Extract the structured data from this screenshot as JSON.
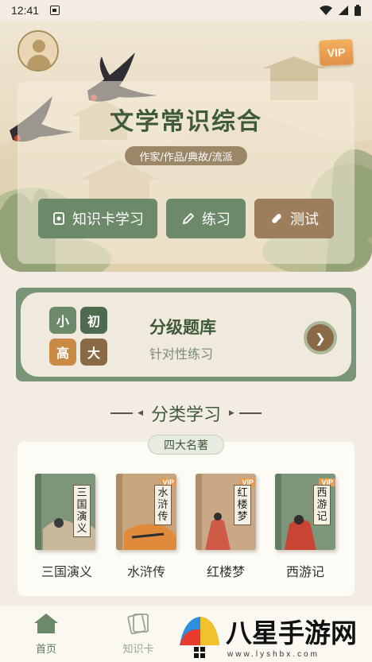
{
  "status_bar": {
    "time": "12:41"
  },
  "hero": {
    "title": "文学常识综合",
    "subtitle": "作家/作品/典故/流派",
    "vip_label": "VIP",
    "buttons": [
      {
        "label": "知识卡学习",
        "icon": "card-icon"
      },
      {
        "label": "练习",
        "icon": "pencil-icon"
      },
      {
        "label": "测试",
        "icon": "bandage-icon"
      }
    ]
  },
  "grade_bank": {
    "tiles": [
      "小",
      "初",
      "高",
      "大"
    ],
    "title": "分级题库",
    "subtitle": "针对性练习",
    "go_icon": "chevron-right-icon"
  },
  "section": {
    "title": "分类学习"
  },
  "classics": {
    "tag": "四大名著",
    "books": [
      {
        "title": "三国演义",
        "label": "三国演义",
        "vip": false,
        "color": "#7d957a"
      },
      {
        "title": "水浒传",
        "label": "水浒传",
        "vip": true,
        "vip_label": "VIP",
        "color": "#c8a57c"
      },
      {
        "title": "红楼梦",
        "label": "红楼梦",
        "vip": true,
        "vip_label": "VIP",
        "color": "#c9a886"
      },
      {
        "title": "西游记",
        "label": "西游记",
        "vip": true,
        "vip_label": "VIP",
        "color": "#7d957a"
      }
    ]
  },
  "tab_bar": {
    "tabs": [
      {
        "label": "首页",
        "icon": "home-icon",
        "active": true
      },
      {
        "label": "知识卡",
        "icon": "cards-icon",
        "active": false
      }
    ]
  },
  "watermark": {
    "text": "八星手游网",
    "url_text": "www.lyshbx.com"
  },
  "colors": {
    "primary_green": "#6c8a6a",
    "brown": "#9c7e5c",
    "orange": "#e59a4f",
    "background": "#f3ece2"
  }
}
